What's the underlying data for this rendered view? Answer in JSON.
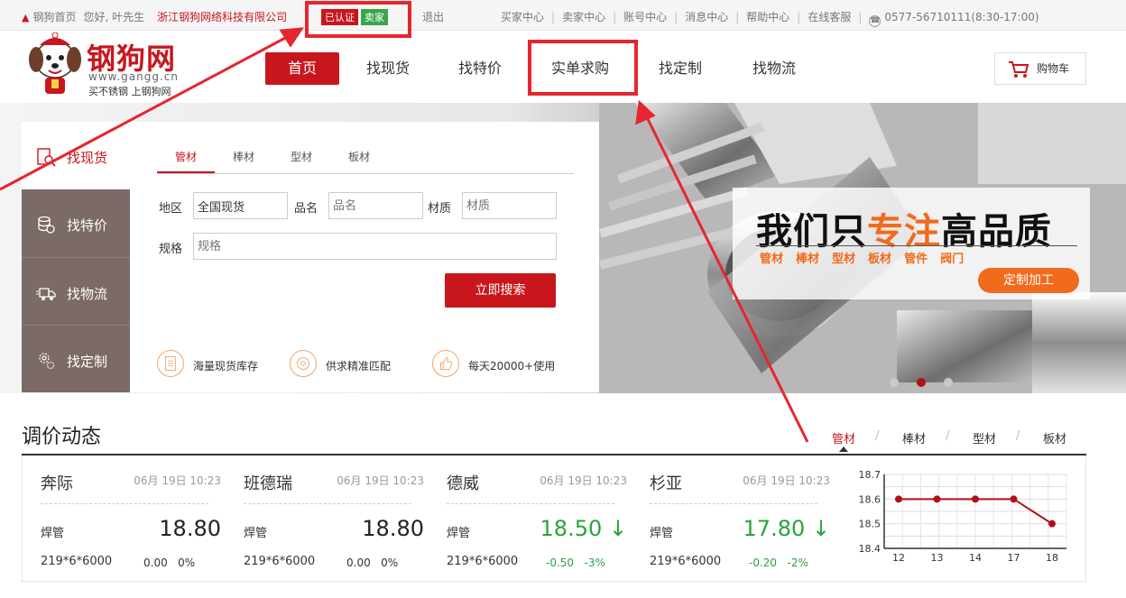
{
  "topbar": {
    "home": "钢狗首页",
    "greeting": "您好, 叶先生",
    "company": "浙江钢狗网络科技有限公司",
    "badge_verified": "已认证",
    "badge_seller": "卖家",
    "logout": "退出",
    "links": [
      "买家中心",
      "卖家中心",
      "账号中心",
      "消息中心",
      "帮助中心",
      "在线客服"
    ],
    "phone": "0577-56710111(8:30-17:00)"
  },
  "logo": {
    "brand": "钢狗网",
    "url": "www.gangg.cn",
    "slogan": "买不锈钢 上钢狗网"
  },
  "nav": {
    "items": [
      "首页",
      "找现货",
      "找特价",
      "实单求购",
      "找定制",
      "找物流"
    ],
    "cart": "购物车"
  },
  "banner": {
    "headline_pre": "我们只",
    "headline_hl": "专注",
    "headline_post": "高品质",
    "categories": [
      "管材",
      "棒材",
      "型材",
      "板材",
      "管件",
      "阀门"
    ],
    "cta": "定制加工"
  },
  "search": {
    "side_tabs": [
      "找现货",
      "找特价",
      "找物流",
      "找定制"
    ],
    "tabs": [
      "管材",
      "棒材",
      "型材",
      "板材"
    ],
    "fields": {
      "region_label": "地区",
      "region_value": "全国现货",
      "name_label": "品名",
      "name_placeholder": "品名",
      "material_label": "材质",
      "material_placeholder": "材质",
      "spec_label": "规格",
      "spec_placeholder": "规格"
    },
    "button": "立即搜索",
    "features": [
      "海量现货库存",
      "供求精准匹配",
      "每天20000+使用"
    ]
  },
  "prices": {
    "title": "调价动态",
    "tabs": [
      "管材",
      "棒材",
      "型材",
      "板材"
    ],
    "cards": [
      {
        "name": "奔际",
        "time": "06月 19日 10:23",
        "kind": "焊管",
        "price": "18.80",
        "arrow": "",
        "spec": "219*6*6000",
        "change": "0.00",
        "pct": "0%",
        "trend": "flat"
      },
      {
        "name": "班德瑞",
        "time": "06月 19日 10:23",
        "kind": "焊管",
        "price": "18.80",
        "arrow": "",
        "spec": "219*6*6000",
        "change": "0.00",
        "pct": "0%",
        "trend": "flat"
      },
      {
        "name": "德威",
        "time": "06月 19日 10:23",
        "kind": "焊管",
        "price": "18.50",
        "arrow": "↓",
        "spec": "219*6*6000",
        "change": "-0.50",
        "pct": "-3%",
        "trend": "down"
      },
      {
        "name": "杉亚",
        "time": "06月 19日 10:23",
        "kind": "焊管",
        "price": "17.80",
        "arrow": "↓",
        "spec": "219*6*6000",
        "change": "-0.20",
        "pct": "-2%",
        "trend": "down"
      }
    ]
  },
  "chart_data": {
    "type": "line",
    "x": [
      "12",
      "13",
      "14",
      "17",
      "18"
    ],
    "values": [
      18.6,
      18.6,
      18.6,
      18.6,
      18.5
    ],
    "yticks": [
      "18.7",
      "18.6",
      "18.5",
      "18.4"
    ],
    "ylim": [
      18.4,
      18.7
    ],
    "grid": true,
    "color": "#b0101a"
  },
  "colors": {
    "brand": "#c8161d",
    "accent": "#f26a1b",
    "down": "#2aa33a",
    "annotation": "#e5262e"
  }
}
